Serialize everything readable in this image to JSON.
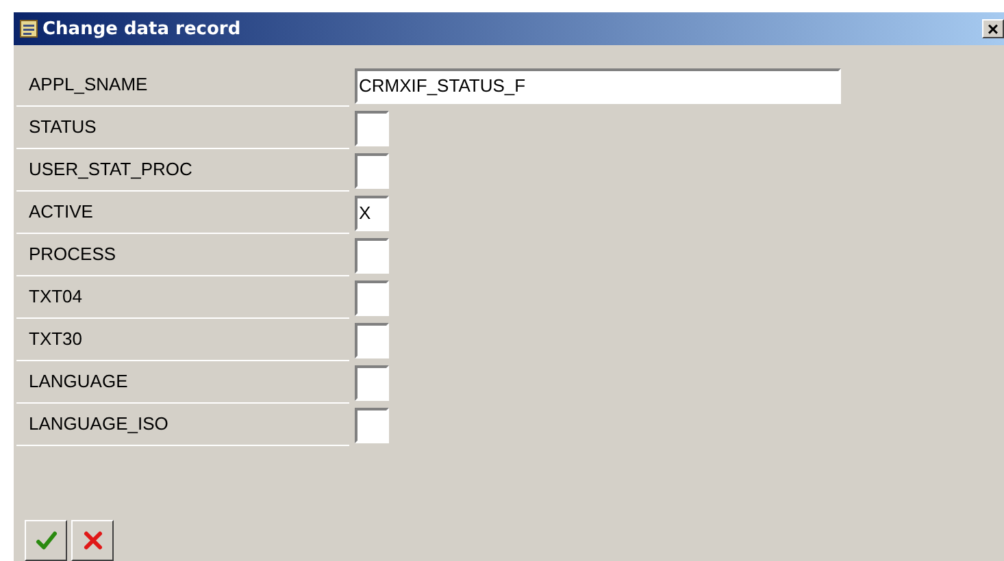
{
  "window": {
    "title": "Change data record",
    "close": "×"
  },
  "fields": [
    {
      "label": "APPL_SNAME",
      "kind": "wide",
      "value": "CRMXIF_STATUS_F"
    },
    {
      "label": "STATUS",
      "kind": "narrow"
    },
    {
      "label": "USER_STAT_PROC",
      "kind": "narrow"
    },
    {
      "label": "ACTIVE",
      "kind": "narrow",
      "value": "X"
    },
    {
      "label": "PROCESS",
      "kind": "narrow"
    },
    {
      "label": "TXT04",
      "kind": "narrow"
    },
    {
      "label": "TXT30",
      "kind": "narrow"
    },
    {
      "label": "LANGUAGE",
      "kind": "narrow"
    },
    {
      "label": "LANGUAGE_ISO",
      "kind": "narrow"
    }
  ],
  "buttons": [
    {
      "kind": "confirm"
    },
    {
      "kind": "cancel"
    }
  ]
}
